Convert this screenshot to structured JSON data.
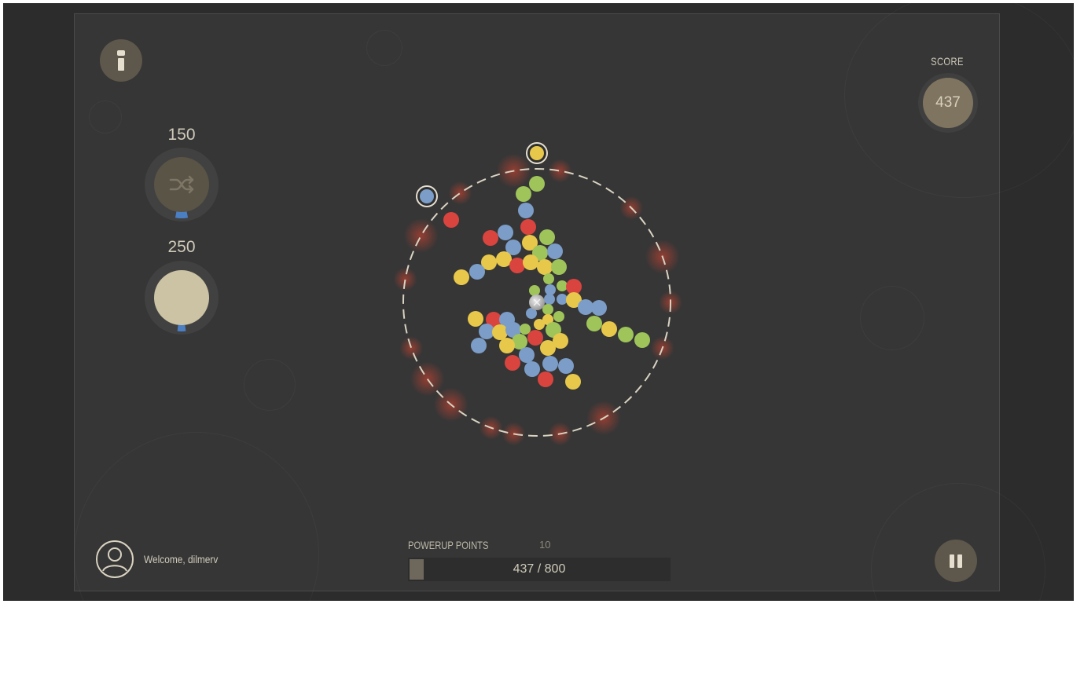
{
  "powerups": [
    {
      "cost": "150",
      "icon": "shuffle-icon",
      "fill": 0.06
    },
    {
      "cost": "250",
      "icon": "bomb-icon",
      "fill": 0.04
    }
  ],
  "score": {
    "label": "SCORE",
    "value": "437"
  },
  "user": {
    "welcome": "Welcome, dilmerv",
    "icon": "user-avatar-icon"
  },
  "powerup_points": {
    "label": "POWERUP POINTS",
    "count": "10",
    "text": "437 / 800",
    "current": 437,
    "max": 800
  },
  "buttons": {
    "info_icon": "info-icon",
    "pause_icon": "pause-icon"
  },
  "colors": {
    "red": "#d9443f",
    "yellow": "#e8c84a",
    "blue": "#7b9dc8",
    "green": "#9fc45a",
    "accent_blue": "#4b7fc4",
    "button": "#5e574b"
  },
  "balls": [
    [
      683,
      234,
      "green"
    ],
    [
      666,
      247,
      "green"
    ],
    [
      669,
      268,
      "blue"
    ],
    [
      574,
      280,
      "red"
    ],
    [
      672,
      289,
      "red"
    ],
    [
      643,
      296,
      "blue"
    ],
    [
      624,
      303,
      "red"
    ],
    [
      696,
      302,
      "green"
    ],
    [
      653,
      315,
      "blue"
    ],
    [
      674,
      309,
      "yellow"
    ],
    [
      687,
      322,
      "green"
    ],
    [
      706,
      320,
      "blue"
    ],
    [
      641,
      330,
      "yellow"
    ],
    [
      622,
      334,
      "yellow"
    ],
    [
      658,
      338,
      "red"
    ],
    [
      675,
      334,
      "yellow"
    ],
    [
      693,
      340,
      "yellow"
    ],
    [
      711,
      340,
      "green"
    ],
    [
      607,
      346,
      "blue"
    ],
    [
      587,
      353,
      "yellow"
    ],
    [
      698,
      355,
      "green"
    ],
    [
      715,
      364,
      "green"
    ],
    [
      730,
      365,
      "red"
    ],
    [
      700,
      369,
      "blue"
    ],
    [
      680,
      370,
      "green"
    ],
    [
      715,
      381,
      "blue"
    ],
    [
      699,
      381,
      "blue"
    ],
    [
      730,
      382,
      "yellow"
    ],
    [
      745,
      391,
      "blue"
    ],
    [
      762,
      392,
      "blue"
    ],
    [
      697,
      394,
      "green"
    ],
    [
      676,
      399,
      "blue"
    ],
    [
      711,
      403,
      "green"
    ],
    [
      605,
      406,
      "yellow"
    ],
    [
      628,
      407,
      "red"
    ],
    [
      645,
      407,
      "blue"
    ],
    [
      697,
      407,
      "yellow"
    ],
    [
      756,
      412,
      "green"
    ],
    [
      775,
      419,
      "yellow"
    ],
    [
      796,
      426,
      "green"
    ],
    [
      817,
      433,
      "green"
    ],
    [
      619,
      422,
      "blue"
    ],
    [
      636,
      423,
      "yellow"
    ],
    [
      653,
      420,
      "blue"
    ],
    [
      668,
      419,
      "green"
    ],
    [
      686,
      413,
      "yellow"
    ],
    [
      704,
      420,
      "green"
    ],
    [
      681,
      430,
      "red"
    ],
    [
      661,
      435,
      "green"
    ],
    [
      645,
      440,
      "yellow"
    ],
    [
      609,
      440,
      "blue"
    ],
    [
      713,
      434,
      "yellow"
    ],
    [
      697,
      443,
      "yellow"
    ],
    [
      670,
      452,
      "blue"
    ],
    [
      652,
      462,
      "red"
    ],
    [
      677,
      470,
      "blue"
    ],
    [
      700,
      463,
      "blue"
    ],
    [
      720,
      466,
      "blue"
    ],
    [
      694,
      483,
      "red"
    ],
    [
      729,
      486,
      "yellow"
    ]
  ],
  "launchers": [
    [
      683,
      195,
      "yellow"
    ],
    [
      543,
      250,
      "blue"
    ]
  ]
}
